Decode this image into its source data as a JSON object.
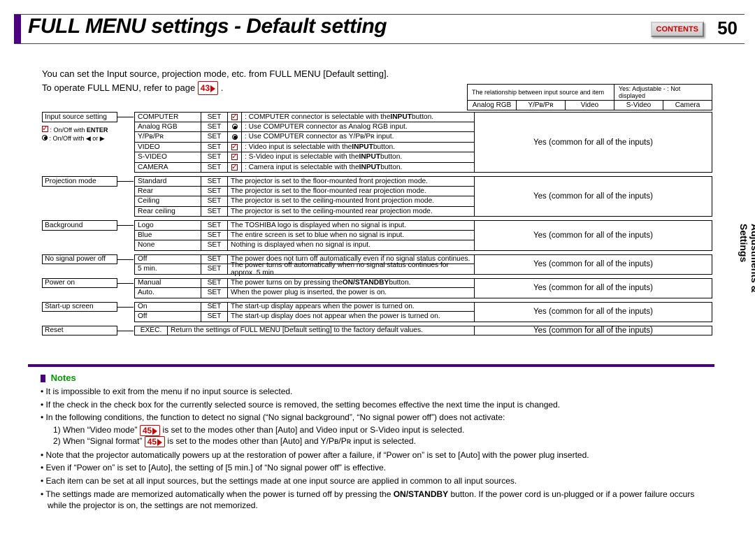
{
  "header": {
    "title": "FULL MENU settings - Default setting",
    "contents_btn": "CONTENTS",
    "page_number": "50",
    "side_tab": "Adjustments &\nSettings"
  },
  "intro": {
    "line1": "You can set the Input source, projection mode, etc. from FULL MENU [Default setting].",
    "line2_a": "To operate FULL MENU, refer to page ",
    "line2_badge": "43",
    "line2_b": "."
  },
  "rel_header": {
    "caption_a": "The relationship between input source and item",
    "caption_b": "Yes: Adjustable    - : Not displayed",
    "cols": [
      "Analog RGB",
      "Y/Pʙ/Pʀ",
      "Video",
      "S-Video",
      "Camera"
    ]
  },
  "legend": {
    "l1": ": On/Off with ENTER",
    "l2": ": On/Off with ◀ or ▶"
  },
  "common_yes": "Yes (common for all of the inputs)",
  "groups": [
    {
      "category": "Input source setting",
      "right_span": 6,
      "rows": [
        {
          "opt": "COMPUTER",
          "set": "SET",
          "ico": "check",
          "desc": ": COMPUTER connector is selectable with the INPUT button."
        },
        {
          "opt": "   Analog RGB",
          "set": "SET",
          "ico": "radio",
          "desc": ": Use COMPUTER connector as Analog RGB input."
        },
        {
          "opt": "   Y/Pʙ/Pʀ",
          "set": "SET",
          "ico": "radio",
          "desc": ": Use COMPUTER connector as Y/Pʙ/Pʀ input."
        },
        {
          "opt": "VIDEO",
          "set": "SET",
          "ico": "check",
          "desc": ": Video input is selectable with the INPUT button."
        },
        {
          "opt": "S-VIDEO",
          "set": "SET",
          "ico": "check",
          "desc": ": S-Video input is selectable with the INPUT button."
        },
        {
          "opt": "CAMERA",
          "set": "SET",
          "ico": "check",
          "desc": ": Camera input is selectable with the INPUT button."
        }
      ]
    },
    {
      "category": "Projection mode",
      "right_span": 4,
      "rows": [
        {
          "opt": "Standard",
          "set": "SET",
          "desc": "The projector is set to the floor-mounted front projection mode."
        },
        {
          "opt": "Rear",
          "set": "SET",
          "desc": "The projector is set to the floor-mounted rear projection mode."
        },
        {
          "opt": "Ceiling",
          "set": "SET",
          "desc": "The projector is set to the ceiling-mounted front projection mode."
        },
        {
          "opt": "Rear ceiling",
          "set": "SET",
          "desc": "The projector is set to the ceiling-mounted rear projection mode."
        }
      ]
    },
    {
      "category": "Background",
      "right_span": 3,
      "rows": [
        {
          "opt": "Logo",
          "set": "SET",
          "desc": "The TOSHIBA logo is displayed when no signal is input."
        },
        {
          "opt": "Blue",
          "set": "SET",
          "desc": "The entire screen is set to blue when no signal is input."
        },
        {
          "opt": "None",
          "set": "SET",
          "desc": "Nothing is displayed when no signal is input."
        }
      ]
    },
    {
      "category": "No signal power off",
      "right_span": 2,
      "rows": [
        {
          "opt": "Off",
          "set": "SET",
          "desc": "The power does not turn off automatically even if no signal status continues."
        },
        {
          "opt": "5 min.",
          "set": "SET",
          "desc": "The power turns off automatically when no signal status continues for approx. 5 min."
        }
      ]
    },
    {
      "category": "Power on",
      "right_span": 2,
      "rows": [
        {
          "opt": "Manual",
          "set": "SET",
          "desc": "The power turns on by pressing the ON/STANDBY button."
        },
        {
          "opt": "Auto.",
          "set": "SET",
          "desc": "When the power plug is inserted, the power is on."
        }
      ]
    },
    {
      "category": "Start-up screen",
      "right_span": 2,
      "rows": [
        {
          "opt": "On",
          "set": "SET",
          "desc": "The start-up display appears when the power is turned on."
        },
        {
          "opt": "Off",
          "set": "SET",
          "desc": "The start-up display does not appear when the power is turned on."
        }
      ]
    },
    {
      "category": "Reset",
      "right_span": 1,
      "rows": [
        {
          "opt": "",
          "set": "EXEC.",
          "desc": "Return the settings of FULL MENU [Default setting] to the factory default values.",
          "full": true
        }
      ]
    }
  ],
  "notes": {
    "header": "Notes",
    "items": [
      "It is impossible to exit from the menu if no input source is selected.",
      "If the check in the check box for the currently selected source is removed, the setting becomes effective the next time the input is changed.",
      "In the following conditions, the function to detect no signal (“No signal background”, “No signal power off”) does not activate:",
      "Note that the projector automatically powers up at the restoration of power after a failure, if “Power on” is set to [Auto] with the power plug inserted.",
      "Even if “Power on” is set to [Auto], the setting of [5 min.] of “No signal power off” is effective.",
      "Each item can be set at all input sources, but the settings made at one input source are applied in common to all input sources.",
      "The settings made are memorized automatically when the power is turned off by pressing the ON/STANDBY button. If the power cord is un-plugged or if a power failure occurs while the projector is on, the settings are not memorized."
    ],
    "sub1_a": "1) When “Video mode” ",
    "sub1_badge": "45",
    "sub1_b": " is set to the modes other than [Auto] and Video input or S-Video input is selected.",
    "sub2_a": "2) When “Signal format” ",
    "sub2_badge": "45",
    "sub2_b": " is set to the modes other than [Auto] and Y/Pʙ/Pʀ input is selected."
  }
}
